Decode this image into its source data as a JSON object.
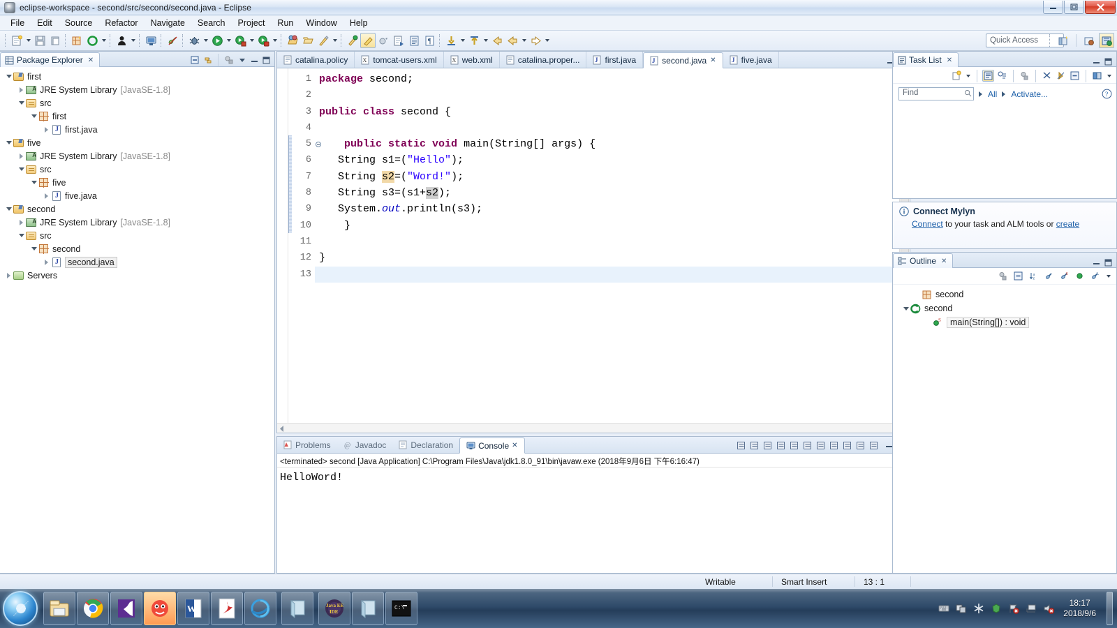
{
  "window": {
    "title": "eclipse-workspace - second/src/second/second.java - Eclipse",
    "minimize_label": "–",
    "maximize_label": "❐",
    "close_label": "✕"
  },
  "menu": {
    "items": [
      "File",
      "Edit",
      "Source",
      "Refactor",
      "Navigate",
      "Search",
      "Project",
      "Run",
      "Window",
      "Help"
    ]
  },
  "toolbar": {
    "quick_access_placeholder": "Quick Access",
    "icons": [
      "new-wizard-icon",
      "save-icon",
      "print-icon",
      "new-java-package-icon",
      "refresh-icon",
      "debug-person-icon",
      "console-icon",
      "skip-breakpoints-icon",
      "debug-icon",
      "run-icon",
      "run-server-icon",
      "stop-server-icon",
      "open-type-icon",
      "open-task-icon",
      "search-icon",
      "next-annotation-icon",
      "previous-annotation-icon",
      "last-edit-icon",
      "back-icon",
      "forward-icon"
    ]
  },
  "package_explorer": {
    "title": "Package Explorer",
    "close_label": "✕",
    "tools": [
      "collapse-all-icon",
      "link-with-editor-icon",
      "focus-icon",
      "view-menu-icon",
      "minimize-icon",
      "maximize-icon"
    ],
    "tree": [
      {
        "label": "first",
        "icon": "project-icon",
        "indent": 0,
        "twisty": "open"
      },
      {
        "label": "JRE System Library",
        "suffix": "[JavaSE-1.8]",
        "icon": "jre-icon",
        "indent": 1,
        "twisty": "closed"
      },
      {
        "label": "src",
        "icon": "source-folder-icon",
        "indent": 1,
        "twisty": "open"
      },
      {
        "label": "first",
        "icon": "package-icon",
        "indent": 2,
        "twisty": "open"
      },
      {
        "label": "first.java",
        "icon": "java-file-icon",
        "indent": 3,
        "twisty": "closed"
      },
      {
        "label": "five",
        "icon": "project-icon",
        "indent": 0,
        "twisty": "open"
      },
      {
        "label": "JRE System Library",
        "suffix": "[JavaSE-1.8]",
        "icon": "jre-icon",
        "indent": 1,
        "twisty": "closed"
      },
      {
        "label": "src",
        "icon": "source-folder-icon",
        "indent": 1,
        "twisty": "open"
      },
      {
        "label": "five",
        "icon": "package-icon",
        "indent": 2,
        "twisty": "open"
      },
      {
        "label": "five.java",
        "icon": "java-file-icon",
        "indent": 3,
        "twisty": "closed"
      },
      {
        "label": "second",
        "icon": "project-icon",
        "indent": 0,
        "twisty": "open"
      },
      {
        "label": "JRE System Library",
        "suffix": "[JavaSE-1.8]",
        "icon": "jre-icon",
        "indent": 1,
        "twisty": "closed"
      },
      {
        "label": "src",
        "icon": "source-folder-icon",
        "indent": 1,
        "twisty": "open"
      },
      {
        "label": "second",
        "icon": "package-icon",
        "indent": 2,
        "twisty": "open"
      },
      {
        "label": "second.java",
        "icon": "java-file-icon",
        "indent": 3,
        "twisty": "closed",
        "selected": true
      },
      {
        "label": "Servers",
        "icon": "servers-icon",
        "indent": 0,
        "twisty": "closed"
      }
    ]
  },
  "editor": {
    "tabs": [
      {
        "label": "catalina.policy",
        "icon": "file-icon",
        "active": false
      },
      {
        "label": "tomcat-users.xml",
        "icon": "xml-file-icon",
        "active": false
      },
      {
        "label": "web.xml",
        "icon": "xml-file-icon",
        "active": false
      },
      {
        "label": "catalina.proper...",
        "icon": "file-icon",
        "active": false
      },
      {
        "label": "first.java",
        "icon": "java-file-icon",
        "active": false
      },
      {
        "label": "second.java",
        "icon": "java-file-icon",
        "active": true,
        "close_label": "✕"
      },
      {
        "label": "five.java",
        "icon": "java-file-icon",
        "active": false
      }
    ],
    "line_numbers": [
      "1",
      "2",
      "3",
      "4",
      "5",
      "6",
      "7",
      "8",
      "9",
      "10",
      "11",
      "12",
      "13"
    ],
    "fold_line": "5",
    "current_line": 13,
    "code_lines": [
      {
        "n": 1,
        "segments": [
          {
            "t": "package ",
            "c": "kw"
          },
          {
            "t": "second;",
            "c": ""
          }
        ]
      },
      {
        "n": 2,
        "segments": []
      },
      {
        "n": 3,
        "segments": [
          {
            "t": "public ",
            "c": "kw"
          },
          {
            "t": "class ",
            "c": "kw"
          },
          {
            "t": "second {",
            "c": ""
          }
        ]
      },
      {
        "n": 4,
        "segments": []
      },
      {
        "n": 5,
        "segments": [
          {
            "t": "    ",
            "c": ""
          },
          {
            "t": "public ",
            "c": "kw"
          },
          {
            "t": "static ",
            "c": "kw"
          },
          {
            "t": "void ",
            "c": "kw"
          },
          {
            "t": "main(String[] args) {",
            "c": ""
          }
        ]
      },
      {
        "n": 6,
        "segments": [
          {
            "t": "   String s1=(",
            "c": ""
          },
          {
            "t": "\"Hello\"",
            "c": "str"
          },
          {
            "t": ");",
            "c": ""
          }
        ]
      },
      {
        "n": 7,
        "segments": [
          {
            "t": "   String ",
            "c": ""
          },
          {
            "t": "s2",
            "c": "hl-write"
          },
          {
            "t": "=(",
            "c": ""
          },
          {
            "t": "\"Word!\"",
            "c": "str"
          },
          {
            "t": ");",
            "c": ""
          }
        ]
      },
      {
        "n": 8,
        "segments": [
          {
            "t": "   String s3=(s1+",
            "c": ""
          },
          {
            "t": "s2",
            "c": "hl-read"
          },
          {
            "t": ");",
            "c": ""
          }
        ]
      },
      {
        "n": 9,
        "segments": [
          {
            "t": "   System.",
            "c": ""
          },
          {
            "t": "out",
            "c": "fld"
          },
          {
            "t": ".println(s3);",
            "c": ""
          }
        ]
      },
      {
        "n": 10,
        "segments": [
          {
            "t": "    }",
            "c": ""
          }
        ]
      },
      {
        "n": 11,
        "segments": []
      },
      {
        "n": 12,
        "segments": [
          {
            "t": "}",
            "c": ""
          }
        ]
      },
      {
        "n": 13,
        "segments": []
      }
    ]
  },
  "console": {
    "tabs": [
      {
        "label": "Problems",
        "icon": "problems-icon",
        "active": false
      },
      {
        "label": "Javadoc",
        "icon": "javadoc-icon",
        "active": false
      },
      {
        "label": "Declaration",
        "icon": "declaration-icon",
        "active": false
      },
      {
        "label": "Console",
        "icon": "console-icon",
        "active": true,
        "close_label": "✕"
      }
    ],
    "header": "<terminated> second [Java Application] C:\\Program Files\\Java\\jdk1.8.0_91\\bin\\javaw.exe (2018年9月6日 下午6:16:47)",
    "output": "HelloWord!",
    "tools": [
      "clear-console-icon",
      "terminate-icon",
      "remove-all-terminated-icon",
      "copy-icon",
      "paste-icon",
      "scroll-lock-icon",
      "show-console-icon",
      "pin-console-icon",
      "new-console-icon",
      "display-selected-icon",
      "open-console-icon"
    ]
  },
  "task_list": {
    "title": "Task List",
    "close_label": "✕",
    "find_placeholder": "Find",
    "filter_all": "All",
    "filter_activate": "Activate...",
    "tools": [
      "new-task-icon",
      "categorize-icon",
      "schedule-icon",
      "focus-icon",
      "filter-icon",
      "presentation-icon",
      "collapse-all-icon",
      "synchronize-icon",
      "view-menu-icon"
    ],
    "help_label": "?"
  },
  "mylyn": {
    "title": "Connect Mylyn",
    "info_icon": "info-icon",
    "link_connect": "Connect",
    "text_middle": " to your task and ALM tools or ",
    "link_create": "create"
  },
  "outline": {
    "title": "Outline",
    "close_label": "✕",
    "tools": [
      "focus-icon",
      "collapse-all-icon",
      "sort-icon",
      "hide-fields-icon",
      "hide-static-icon",
      "hide-nonpublic-icon",
      "hide-local-icon",
      "view-menu-icon"
    ],
    "items": [
      {
        "label": "second",
        "icon": "package-icon",
        "indent": 1,
        "twisty": "none"
      },
      {
        "label": "second",
        "icon": "class-icon",
        "indent": 0,
        "twisty": "open"
      },
      {
        "label": "main(String[]) : void",
        "icon": "method-static-icon",
        "indent": 2,
        "twisty": "none",
        "selected": true
      }
    ]
  },
  "statusbar": {
    "writable": "Writable",
    "insert_mode": "Smart Insert",
    "position": "13 : 1"
  },
  "taskbar": {
    "start_label": "start-orb",
    "items": [
      "windows-explorer-icon",
      "google-chrome-icon",
      "visual-studio-icon",
      "mascot-app-icon",
      "microsoft-word-icon",
      "adobe-reader-icon",
      "internet-explorer-icon",
      "window-icon",
      "java-ee-ide-icon",
      "window-icon-2",
      "command-prompt-icon"
    ],
    "tray_icons": [
      "keyboard-icon",
      "windows-tile-icon",
      "asterisk-icon",
      "shield-green-icon",
      "flag-error-icon",
      "network-icon",
      "volume-mute-icon"
    ],
    "time": "18:17",
    "date": "2018/9/6"
  },
  "colors": {
    "keyword": "#7f0055",
    "string": "#2a00ff",
    "field": "#0000c0",
    "occurrence_write": "#f2d9a8",
    "occurrence_read": "#d0d0d0",
    "link": "#1c5fa8",
    "accent": "#33506f"
  }
}
